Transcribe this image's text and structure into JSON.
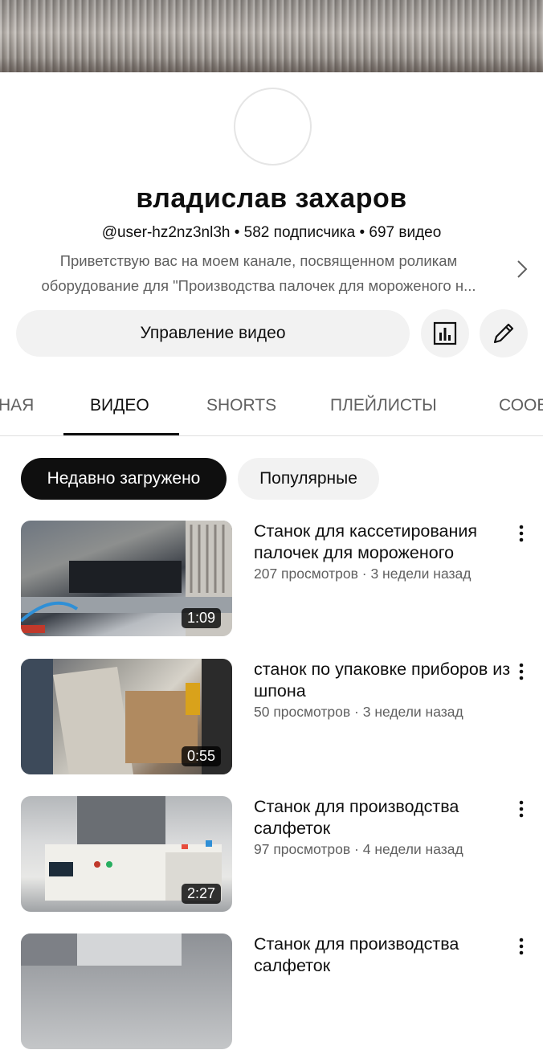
{
  "channel": {
    "name": "владислав захаров",
    "meta": "@user-hz2nz3nl3h • 582 подписчика • 697 видео",
    "description_line1": "Приветствую вас на моем канале, посвященном роликам",
    "description_line2": "оборудование для  \"Производства палочек для мороженого н..."
  },
  "actions": {
    "manage_label": "Управление видео"
  },
  "tabs": [
    {
      "label": "НАЯ"
    },
    {
      "label": "ВИДЕО"
    },
    {
      "label": "SHORTS"
    },
    {
      "label": "ПЛЕЙЛИСТЫ"
    },
    {
      "label": "СООБ"
    }
  ],
  "active_tab_index": 1,
  "chips": {
    "recent": "Недавно загружено",
    "popular": "Популярные"
  },
  "videos": [
    {
      "title": "Станок для кассетирования палочек для мороженого",
      "meta": "207 просмотров · 3 недели назад",
      "duration": "1:09"
    },
    {
      "title": "станок по упаковке приборов из шпона",
      "meta": "50 просмотров · 3 недели назад",
      "duration": "0:55"
    },
    {
      "title": "Станок для производства салфеток",
      "meta": "97 просмотров · 4 недели назад",
      "duration": "2:27"
    },
    {
      "title": "Станок для производства салфеток",
      "meta": "",
      "duration": ""
    }
  ],
  "icons": {
    "analytics": "bar-chart-icon",
    "edit": "pencil-icon",
    "chevron": "chevron-right-icon",
    "more": "more-vertical-icon"
  },
  "colors": {
    "text_primary": "#0f0f0f",
    "text_secondary": "#606060",
    "chip_active_bg": "#0f0f0f",
    "button_bg": "#f2f2f2"
  }
}
